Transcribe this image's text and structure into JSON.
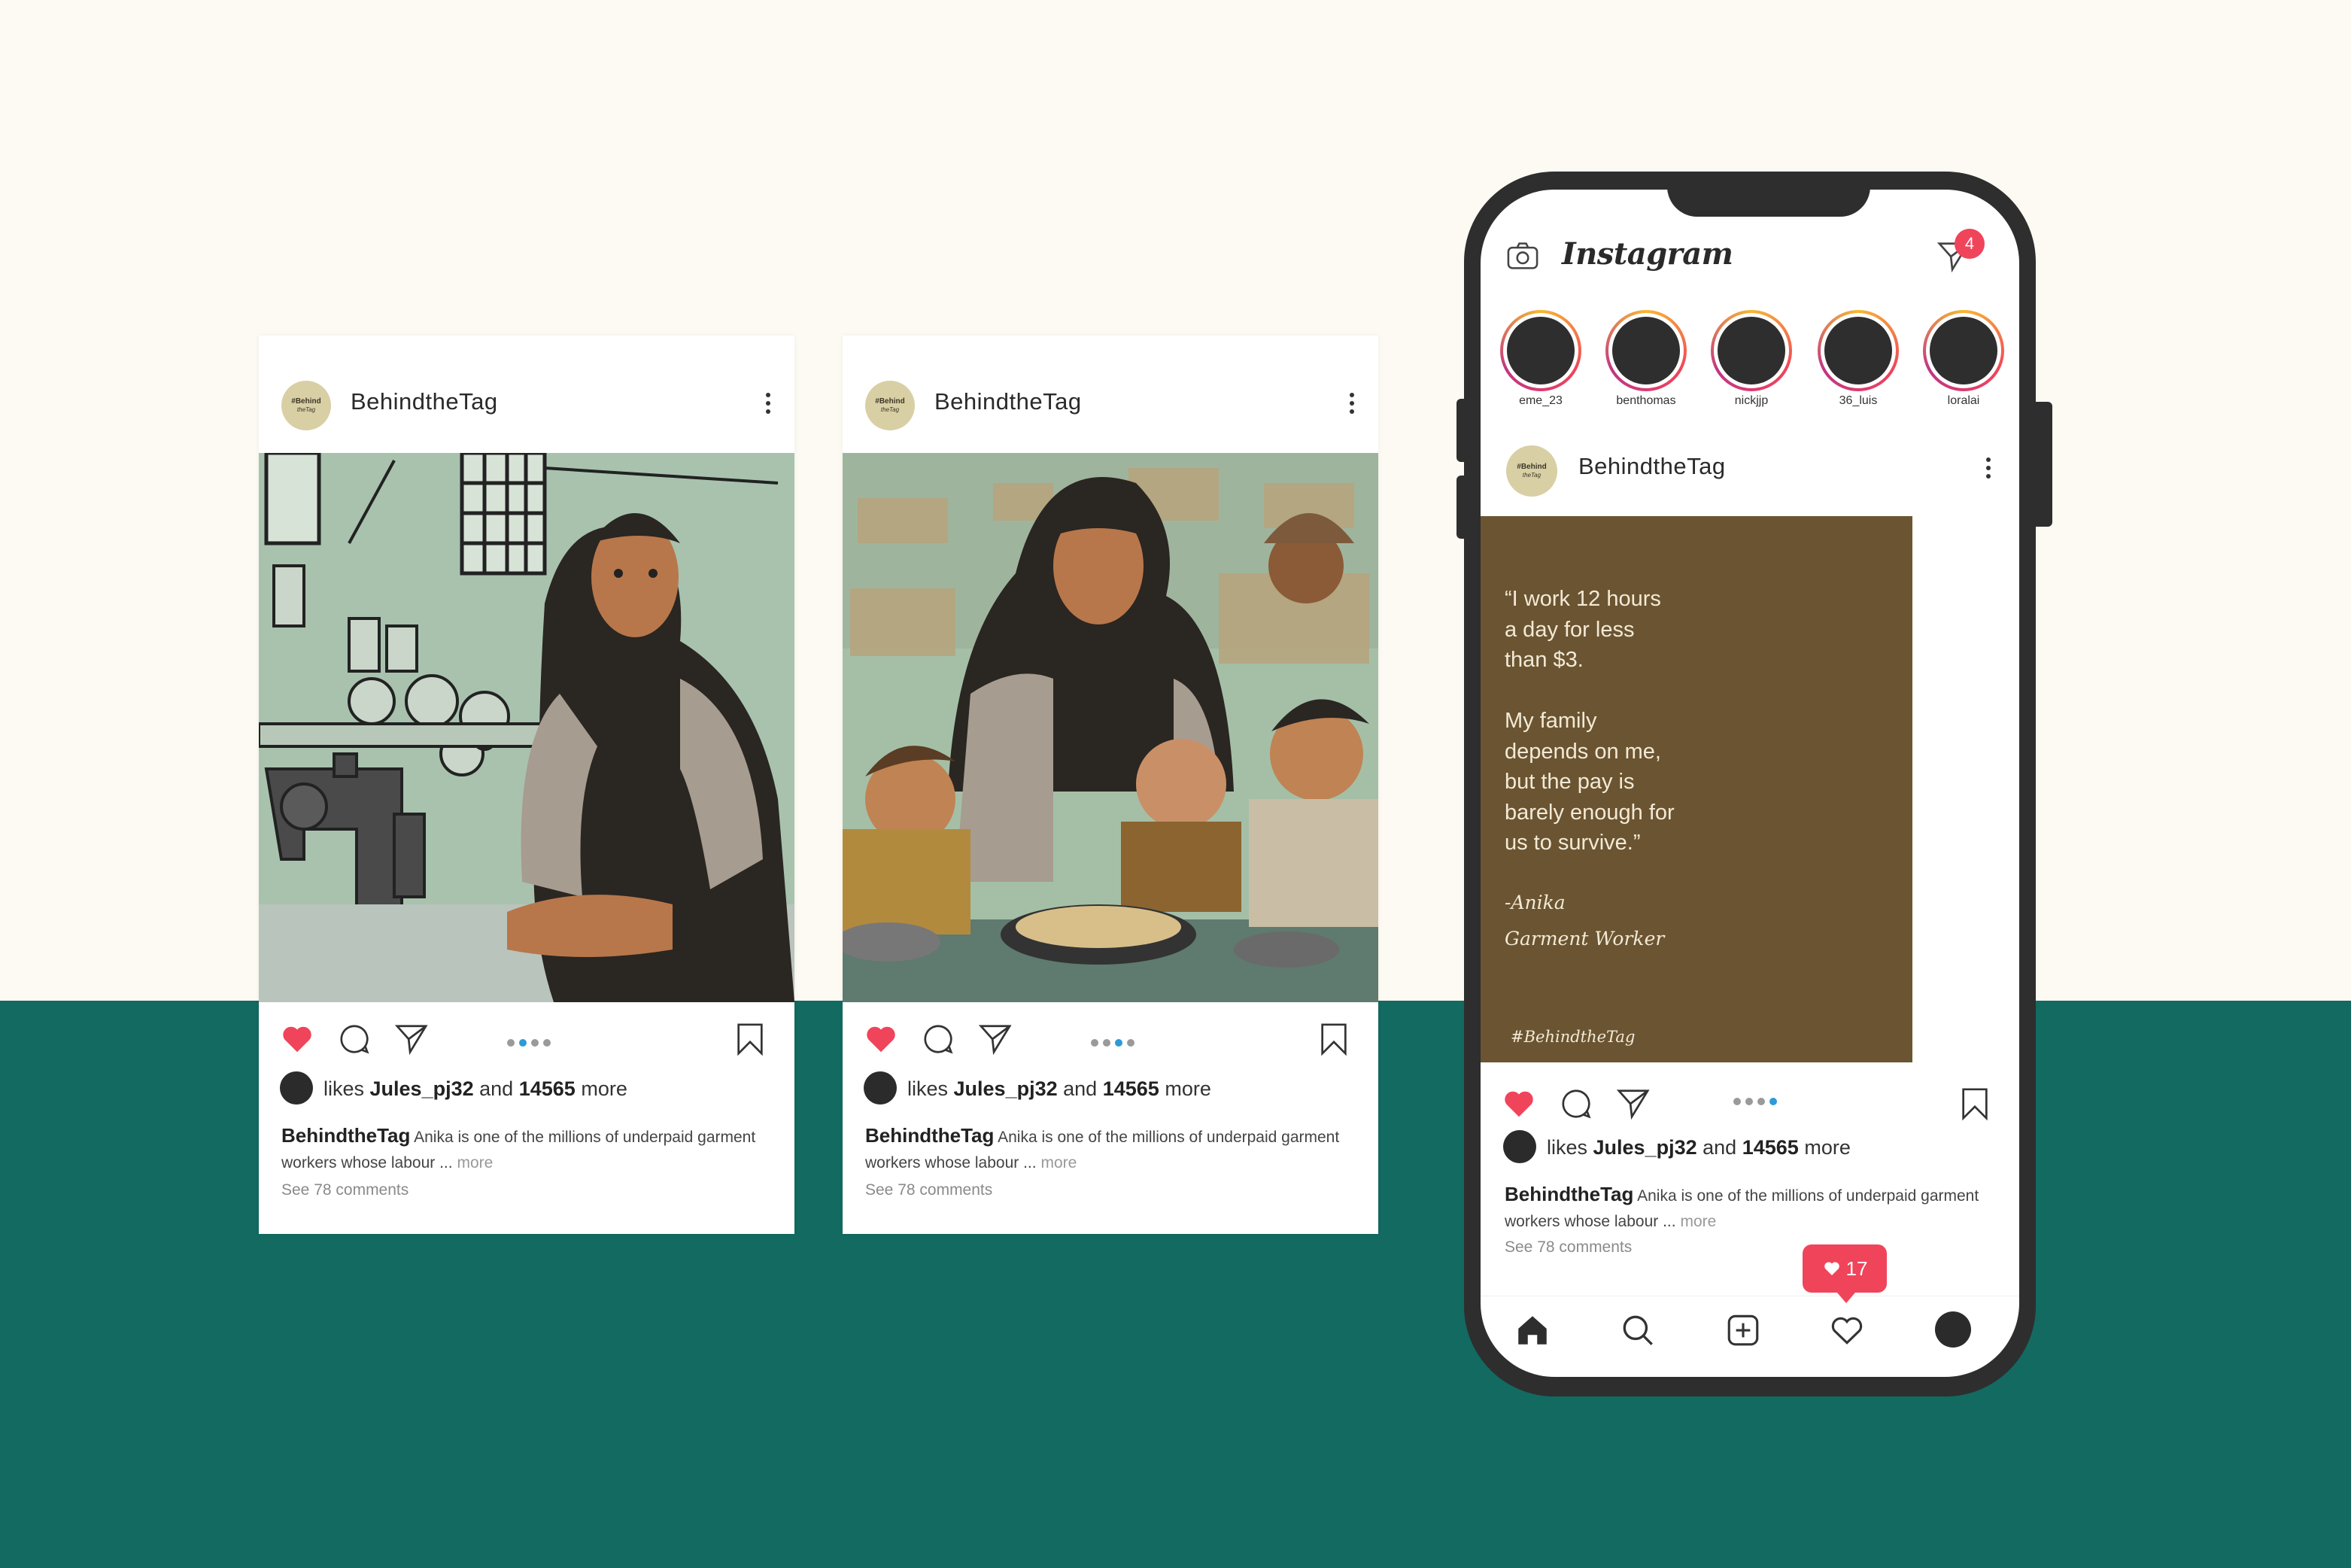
{
  "posts": [
    {
      "username": "BehindtheTag",
      "avatar_line1": "#Behind",
      "avatar_line2": "theTag",
      "likes_prefix": "likes",
      "likes_user": "Jules_pj32",
      "likes_and": "and",
      "likes_count": "14565",
      "likes_suffix": "more",
      "caption_user": "BehindtheTag",
      "caption_text": "Anika is one of the millions of underpaid garment workers whose labour ...",
      "caption_more": "more",
      "comments": "See 78 comments",
      "carousel_active_index": 1,
      "carousel_count": 4
    },
    {
      "username": "BehindtheTag",
      "avatar_line1": "#Behind",
      "avatar_line2": "theTag",
      "likes_prefix": "likes",
      "likes_user": "Jules_pj32",
      "likes_and": "and",
      "likes_count": "14565",
      "likes_suffix": "more",
      "caption_user": "BehindtheTag",
      "caption_text": "Anika is one of the millions of underpaid garment workers whose labour ...",
      "caption_more": "more",
      "comments": "See 78 comments",
      "carousel_active_index": 2,
      "carousel_count": 4
    }
  ],
  "phone": {
    "app_name": "Instagram",
    "dm_badge": "4",
    "stories": [
      "eme_23",
      "benthomas",
      "nickjjp",
      "36_luis",
      "loralai"
    ],
    "post": {
      "username": "BehindtheTag",
      "avatar_line1": "#Behind",
      "avatar_line2": "theTag",
      "quote": "“I work 12 hours\na day for less\nthan $3.\n\nMy family\ndepends on me,\nbut the pay is\nbarely enough for\nus to survive.”",
      "quote_author": "-Anika",
      "quote_role": "Garment Worker",
      "quote_tag": "#BehindtheTag",
      "likes_prefix": "likes",
      "likes_user": "Jules_pj32",
      "likes_and": "and",
      "likes_count": "14565",
      "likes_suffix": "more",
      "caption_user": "BehindtheTag",
      "caption_text": "Anika is one of the millions of underpaid garment workers whose labour ...",
      "caption_more": "more",
      "comments": "See 78 comments",
      "carousel_active_index": 3,
      "carousel_count": 4
    },
    "notification_count": "17"
  },
  "colors": {
    "background_top": "#fdfaf3",
    "background_bottom": "#126a61",
    "like_red": "#f0445b",
    "quote_panel": "#6b5431",
    "carousel_active": "#2e9ad6"
  },
  "icons": [
    "heart-icon",
    "comment-icon",
    "send-icon",
    "bookmark-icon",
    "more-icon",
    "camera-icon",
    "direct-icon",
    "home-icon",
    "search-icon",
    "add-icon",
    "activity-icon",
    "profile-icon"
  ]
}
